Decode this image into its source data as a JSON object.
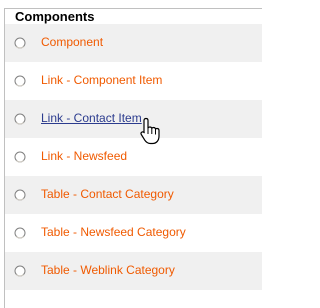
{
  "panel": {
    "legend": "Components"
  },
  "items": [
    {
      "label": "Component",
      "style": "alt"
    },
    {
      "label": "Link - Component Item",
      "style": "white"
    },
    {
      "label": "Link - Contact Item",
      "style": "alt",
      "hovered": true
    },
    {
      "label": "Link - Newsfeed",
      "style": "white"
    },
    {
      "label": "Table - Contact Category",
      "style": "alt"
    },
    {
      "label": "Table - Newsfeed Category",
      "style": "white"
    },
    {
      "label": "Table - Weblink Category",
      "style": "alt"
    }
  ],
  "colors": {
    "link": "#f05a00",
    "hover_link": "#2b3b8e",
    "row_alt": "#f0f0f0"
  },
  "cursor": {
    "icon": "hand-pointer-icon"
  }
}
